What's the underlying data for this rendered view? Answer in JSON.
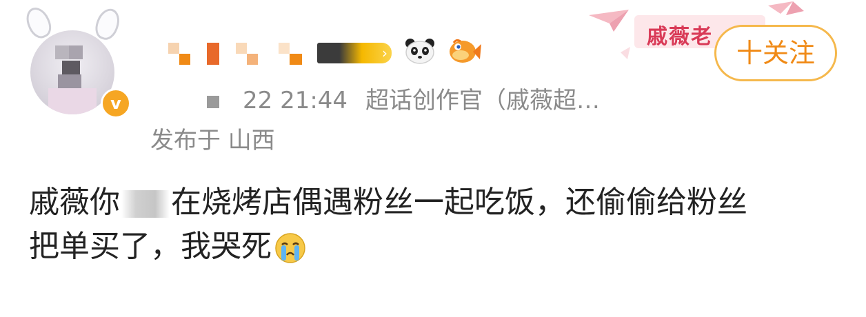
{
  "header": {
    "banner_text": "戚薇老",
    "follow_label": "十关注"
  },
  "author": {
    "verified_symbol": "v",
    "vip_arrow": "›",
    "badges": [
      "panda-icon",
      "fish-icon"
    ]
  },
  "meta": {
    "time": "22 21:44",
    "source": "超话创作官（戚薇超…",
    "location": "发布于 山西"
  },
  "post": {
    "line1_before": "戚薇你",
    "line1_after": "在烧烤店偶遇粉丝一起吃饭，还偷偷给粉丝",
    "line2": "把单买了，我哭死",
    "emoji": "crying-icon"
  },
  "colors": {
    "follow_accent": "#f08a16",
    "follow_border": "#f5b84c",
    "verified": "#f6a623",
    "banner_text": "#d93a57",
    "meta_text": "#8a8a8a",
    "body_text": "#222222"
  }
}
